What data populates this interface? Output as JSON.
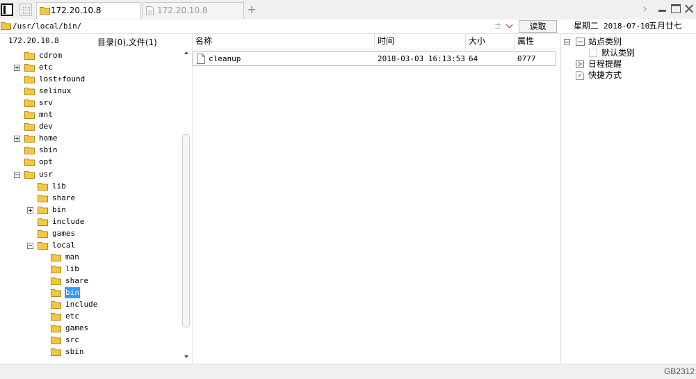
{
  "tabs": [
    {
      "label": "172.20.10.8",
      "active": true
    },
    {
      "label": "172.20.10.8",
      "active": false
    }
  ],
  "address": {
    "path": "/usr/local/bin/",
    "extra_symbol": "±",
    "read_button": "读取"
  },
  "left_header": {
    "host": "172.20.10.8",
    "counts": "目录(0),文件(1)"
  },
  "tree": [
    {
      "name": "cdrom",
      "depth": 0,
      "expander": "none"
    },
    {
      "name": "etc",
      "depth": 0,
      "expander": "plus"
    },
    {
      "name": "lost+found",
      "depth": 0,
      "expander": "none"
    },
    {
      "name": "selinux",
      "depth": 0,
      "expander": "none"
    },
    {
      "name": "srv",
      "depth": 0,
      "expander": "none"
    },
    {
      "name": "mnt",
      "depth": 0,
      "expander": "none"
    },
    {
      "name": "dev",
      "depth": 0,
      "expander": "none"
    },
    {
      "name": "home",
      "depth": 0,
      "expander": "plus"
    },
    {
      "name": "sbin",
      "depth": 0,
      "expander": "none"
    },
    {
      "name": "opt",
      "depth": 0,
      "expander": "none"
    },
    {
      "name": "usr",
      "depth": 0,
      "expander": "minus"
    },
    {
      "name": "lib",
      "depth": 1,
      "expander": "none"
    },
    {
      "name": "share",
      "depth": 1,
      "expander": "none"
    },
    {
      "name": "bin",
      "depth": 1,
      "expander": "plus"
    },
    {
      "name": "include",
      "depth": 1,
      "expander": "none"
    },
    {
      "name": "games",
      "depth": 1,
      "expander": "none"
    },
    {
      "name": "local",
      "depth": 1,
      "expander": "minus"
    },
    {
      "name": "man",
      "depth": 2,
      "expander": "none"
    },
    {
      "name": "lib",
      "depth": 2,
      "expander": "none"
    },
    {
      "name": "share",
      "depth": 2,
      "expander": "none"
    },
    {
      "name": "bin",
      "depth": 2,
      "expander": "none",
      "selected": true
    },
    {
      "name": "include",
      "depth": 2,
      "expander": "none"
    },
    {
      "name": "etc",
      "depth": 2,
      "expander": "none"
    },
    {
      "name": "games",
      "depth": 2,
      "expander": "none"
    },
    {
      "name": "src",
      "depth": 2,
      "expander": "none"
    },
    {
      "name": "sbin",
      "depth": 2,
      "expander": "none"
    }
  ],
  "file_list": {
    "columns": [
      "名称",
      "时间",
      "大小",
      "属性"
    ],
    "rows": [
      {
        "name": "cleanup",
        "time": "2018-03-03 16:13:53",
        "size": "64",
        "attr": "0777"
      }
    ]
  },
  "right_panel": {
    "weekday": "星期二",
    "date": "2018-07-10",
    "lunar": "五月廿七",
    "items": [
      {
        "label": "站点类别",
        "icon": "site-category-icon",
        "expander": "minus",
        "depth": 0
      },
      {
        "label": "默认类别",
        "icon": "default-category-icon",
        "expander": "none",
        "depth": 1
      },
      {
        "label": "日程提醒",
        "icon": "schedule-icon",
        "expander": "none",
        "depth": 0
      },
      {
        "label": "快捷方式",
        "icon": "shortcut-icon",
        "expander": "none",
        "depth": 0
      }
    ]
  },
  "status": {
    "encoding": "GB2312"
  },
  "colors": {
    "folder": "#f2c744",
    "selection": "#3399ff",
    "accent_red": "#c03030"
  }
}
